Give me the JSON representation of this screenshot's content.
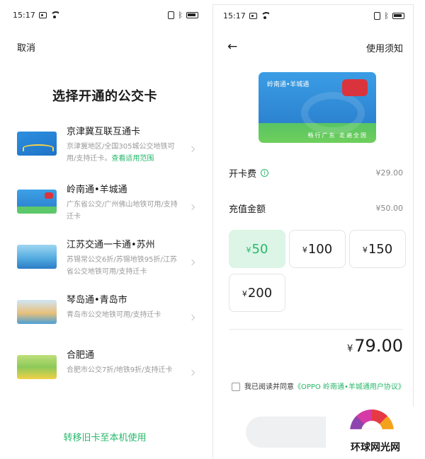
{
  "status_bar": {
    "time": "15:17"
  },
  "left": {
    "cancel_label": "取消",
    "title": "选择开通的公交卡",
    "cards": [
      {
        "name": "京津冀互联互通卡",
        "desc": "京津冀地区/全国305城公交地铁可用/支持迁卡。",
        "link": "查看适用范围"
      },
      {
        "name": "岭南通•羊城通",
        "desc": "广东省公交/广州佛山地铁可用/支持迁卡"
      },
      {
        "name": "江苏交通一卡通•苏州",
        "desc": "苏锡常公交6折/苏锡地铁95折/江苏省公交地铁可用/支持迁卡"
      },
      {
        "name": "琴岛通•青岛市",
        "desc": "青岛市公交地铁可用/支持迁卡"
      },
      {
        "name": "合肥通",
        "desc": "合肥市公交7折/地铁9折/支持迁卡"
      }
    ],
    "transfer_label": "转移旧卡至本机使用"
  },
  "right": {
    "back_icon": "arrow-left-icon",
    "notice_label": "使用须知",
    "card_logo_text": "岭南通•羊城通",
    "card_slogan": "畅行广东 走遍全国",
    "open_fee_label": "开卡费",
    "open_fee_value": "¥29.00",
    "recharge_label": "充值金额",
    "recharge_value": "¥50.00",
    "currency": "¥",
    "amounts": [
      {
        "value": "50",
        "selected": true
      },
      {
        "value": "100",
        "selected": false
      },
      {
        "value": "150",
        "selected": false
      },
      {
        "value": "200",
        "selected": false
      }
    ],
    "total": "79.00",
    "agree_prefix": "我已阅读并同意",
    "agree_link": "《OPPO 岭南通•羊城通用户协议》"
  },
  "watermark": {
    "text": "环球网光网"
  },
  "colors": {
    "accent": "#27b86b",
    "selected_bg": "#dcf5e6"
  }
}
